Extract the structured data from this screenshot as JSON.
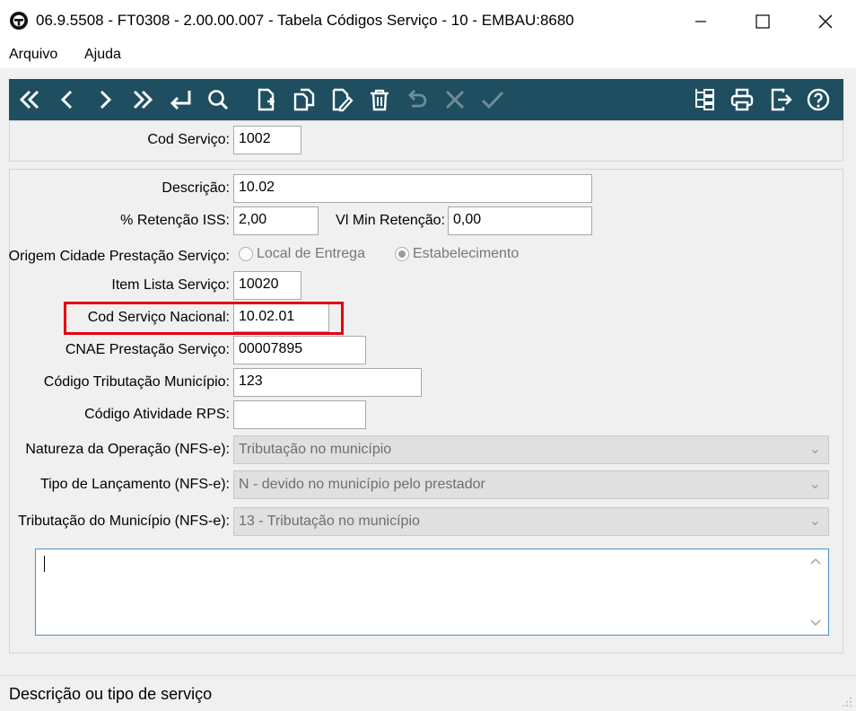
{
  "window": {
    "title": "06.9.5508 - FT0308 - 2.00.00.007 - Tabela Códigos Serviço - 10 - EMBAU:8680"
  },
  "menu": {
    "items": [
      {
        "label": "Arquivo"
      },
      {
        "label": "Ajuda"
      }
    ]
  },
  "toolbar": {
    "left_icons": [
      "first-icon",
      "previous-icon",
      "next-icon",
      "last-icon",
      "enter-icon",
      "search-icon",
      "new-icon",
      "copy-icon",
      "edit-icon",
      "delete-icon",
      "undo-icon",
      "cancel-icon",
      "confirm-icon"
    ],
    "right_icons": [
      "tree-icon",
      "print-icon",
      "exit-icon",
      "help-icon"
    ],
    "color": "#1e4e5f"
  },
  "header": {
    "cod_servico_label": "Cod Serviço:",
    "cod_servico_value": "1002"
  },
  "form": {
    "descricao_label": "Descrição:",
    "descricao_value": "10.02",
    "retencao_iss_label": "% Retenção ISS:",
    "retencao_iss_value": "2,00",
    "vl_min_retencao_label": "Vl Min Retenção:",
    "vl_min_retencao_value": "0,00",
    "origem_label": "Origem Cidade Prestação Serviço:",
    "origem_option_local": "Local de Entrega",
    "origem_option_estab": "Estabelecimento",
    "origem_selected": "Estabelecimento",
    "item_lista_label": "Item Lista Serviço:",
    "item_lista_value": "10020",
    "cod_nacional_label": "Cod Serviço Nacional:",
    "cod_nacional_value": "10.02.01",
    "cnae_label": "CNAE Prestação Serviço:",
    "cnae_value": "00007895",
    "cod_trib_label": "Código Tributação Município:",
    "cod_trib_value": "123",
    "cod_ativ_label": "Código Atividade RPS:",
    "cod_ativ_value": "",
    "natureza_label": "Natureza da Operação (NFS-e):",
    "natureza_value": "Tributação no município",
    "tipo_lanc_label": "Tipo de Lançamento (NFS-e):",
    "tipo_lanc_value": "N - devido no município pelo prestador",
    "tributacao_label": "Tributação do Município (NFS-e):",
    "tributacao_value": "13 - Tributação no município",
    "memo_value": ""
  },
  "status": {
    "text": "Descrição ou tipo de serviço"
  },
  "colors": {
    "highlight": "#e3000f",
    "memo_border": "#4a90c8"
  }
}
